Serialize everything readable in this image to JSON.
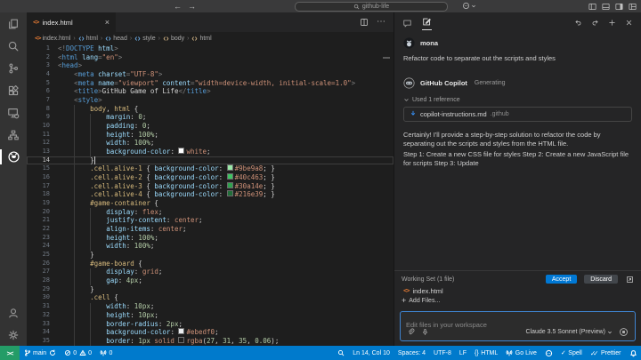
{
  "titlebar": {
    "search_value": "github-life"
  },
  "tabs": {
    "active": "index.html"
  },
  "breadcrumbs": [
    {
      "label": "index.html"
    },
    {
      "label": "html"
    },
    {
      "label": "head"
    },
    {
      "label": "style"
    },
    {
      "label": "body"
    },
    {
      "label": "html"
    }
  ],
  "editor": {
    "current_line": 14,
    "lines": [
      {
        "n": 1,
        "k": [
          [
            "p",
            "<!"
          ],
          [
            "t",
            "DOCTYPE"
          ],
          [
            "a",
            " html"
          ],
          [
            "p",
            ">"
          ]
        ]
      },
      {
        "n": 2,
        "k": [
          [
            "p",
            "<"
          ],
          [
            "t",
            "html"
          ],
          [
            "a",
            " lang"
          ],
          [
            "p",
            "="
          ],
          [
            "s",
            "\"en\""
          ],
          [
            "p",
            ">"
          ]
        ]
      },
      {
        "n": 3,
        "k": [
          [
            "p",
            "<"
          ],
          [
            "t",
            "head"
          ],
          [
            "p",
            ">"
          ]
        ]
      },
      {
        "n": 4,
        "k": [
          [
            "w",
            "    "
          ],
          [
            "p",
            "<"
          ],
          [
            "t",
            "meta"
          ],
          [
            "a",
            " charset"
          ],
          [
            "p",
            "="
          ],
          [
            "s",
            "\"UTF-8\""
          ],
          [
            "p",
            ">"
          ]
        ]
      },
      {
        "n": 5,
        "k": [
          [
            "w",
            "    "
          ],
          [
            "p",
            "<"
          ],
          [
            "t",
            "meta"
          ],
          [
            "a",
            " name"
          ],
          [
            "p",
            "="
          ],
          [
            "s",
            "\"viewport\""
          ],
          [
            "a",
            " content"
          ],
          [
            "p",
            "="
          ],
          [
            "s",
            "\"width=device-width, initial-scale=1.0\""
          ],
          [
            "p",
            ">"
          ]
        ]
      },
      {
        "n": 6,
        "k": [
          [
            "w",
            "    "
          ],
          [
            "p",
            "<"
          ],
          [
            "t",
            "title"
          ],
          [
            "p",
            ">"
          ],
          [
            "w",
            "GitHub Game of Life"
          ],
          [
            "p",
            "</"
          ],
          [
            "t",
            "title"
          ],
          [
            "p",
            ">"
          ]
        ]
      },
      {
        "n": 7,
        "k": [
          [
            "w",
            "    "
          ],
          [
            "p",
            "<"
          ],
          [
            "t",
            "style"
          ],
          [
            "p",
            ">"
          ]
        ]
      },
      {
        "n": 8,
        "k": [
          [
            "w",
            "        "
          ],
          [
            "e",
            "body"
          ],
          [
            "w",
            ","
          ],
          [
            "e",
            " html"
          ],
          [
            "w",
            " {"
          ]
        ]
      },
      {
        "n": 9,
        "k": [
          [
            "w",
            "            "
          ],
          [
            "r",
            "margin"
          ],
          [
            "w",
            ": "
          ],
          [
            "n",
            "0"
          ],
          [
            "w",
            ";"
          ]
        ]
      },
      {
        "n": 10,
        "k": [
          [
            "w",
            "            "
          ],
          [
            "r",
            "padding"
          ],
          [
            "w",
            ": "
          ],
          [
            "n",
            "0"
          ],
          [
            "w",
            ";"
          ]
        ]
      },
      {
        "n": 11,
        "k": [
          [
            "w",
            "            "
          ],
          [
            "r",
            "height"
          ],
          [
            "w",
            ": "
          ],
          [
            "n",
            "100%"
          ],
          [
            "w",
            ";"
          ]
        ]
      },
      {
        "n": 12,
        "k": [
          [
            "w",
            "            "
          ],
          [
            "r",
            "width"
          ],
          [
            "w",
            ": "
          ],
          [
            "n",
            "100%"
          ],
          [
            "w",
            ";"
          ]
        ]
      },
      {
        "n": 13,
        "k": [
          [
            "w",
            "            "
          ],
          [
            "r",
            "background-color"
          ],
          [
            "w",
            ": "
          ],
          [
            "sw",
            "#ffffff"
          ],
          [
            "v",
            "white"
          ],
          [
            "w",
            ";"
          ]
        ]
      },
      {
        "n": 14,
        "k": [
          [
            "w",
            "        }"
          ]
        ]
      },
      {
        "n": 15,
        "k": [
          [
            "w",
            "        "
          ],
          [
            "e",
            ".cell.alive-1"
          ],
          [
            "w",
            " { "
          ],
          [
            "r",
            "background-color"
          ],
          [
            "w",
            ": "
          ],
          [
            "sw",
            "#9be9a8"
          ],
          [
            "v",
            "#9be9a8"
          ],
          [
            "w",
            "; }"
          ]
        ]
      },
      {
        "n": 16,
        "k": [
          [
            "w",
            "        "
          ],
          [
            "e",
            ".cell.alive-2"
          ],
          [
            "w",
            " { "
          ],
          [
            "r",
            "background-color"
          ],
          [
            "w",
            ": "
          ],
          [
            "sw",
            "#40c463"
          ],
          [
            "v",
            "#40c463"
          ],
          [
            "w",
            "; }"
          ]
        ]
      },
      {
        "n": 17,
        "k": [
          [
            "w",
            "        "
          ],
          [
            "e",
            ".cell.alive-3"
          ],
          [
            "w",
            " { "
          ],
          [
            "r",
            "background-color"
          ],
          [
            "w",
            ": "
          ],
          [
            "sw",
            "#30a14e"
          ],
          [
            "v",
            "#30a14e"
          ],
          [
            "w",
            "; }"
          ]
        ]
      },
      {
        "n": 18,
        "k": [
          [
            "w",
            "        "
          ],
          [
            "e",
            ".cell.alive-4"
          ],
          [
            "w",
            " { "
          ],
          [
            "r",
            "background-color"
          ],
          [
            "w",
            ": "
          ],
          [
            "sw",
            "#216e39"
          ],
          [
            "v",
            "#216e39"
          ],
          [
            "w",
            "; }"
          ]
        ]
      },
      {
        "n": 19,
        "k": [
          [
            "w",
            "        "
          ],
          [
            "e",
            "#game-container"
          ],
          [
            "w",
            " {"
          ]
        ]
      },
      {
        "n": 20,
        "k": [
          [
            "w",
            "            "
          ],
          [
            "r",
            "display"
          ],
          [
            "w",
            ": "
          ],
          [
            "v",
            "flex"
          ],
          [
            "w",
            ";"
          ]
        ]
      },
      {
        "n": 21,
        "k": [
          [
            "w",
            "            "
          ],
          [
            "r",
            "justify-content"
          ],
          [
            "w",
            ": "
          ],
          [
            "v",
            "center"
          ],
          [
            "w",
            ";"
          ]
        ]
      },
      {
        "n": 22,
        "k": [
          [
            "w",
            "            "
          ],
          [
            "r",
            "align-items"
          ],
          [
            "w",
            ": "
          ],
          [
            "v",
            "center"
          ],
          [
            "w",
            ";"
          ]
        ]
      },
      {
        "n": 23,
        "k": [
          [
            "w",
            "            "
          ],
          [
            "r",
            "height"
          ],
          [
            "w",
            ": "
          ],
          [
            "n",
            "100%"
          ],
          [
            "w",
            ";"
          ]
        ]
      },
      {
        "n": 24,
        "k": [
          [
            "w",
            "            "
          ],
          [
            "r",
            "width"
          ],
          [
            "w",
            ": "
          ],
          [
            "n",
            "100%"
          ],
          [
            "w",
            ";"
          ]
        ]
      },
      {
        "n": 25,
        "k": [
          [
            "w",
            "        }"
          ]
        ]
      },
      {
        "n": 26,
        "k": [
          [
            "w",
            "        "
          ],
          [
            "e",
            "#game-board"
          ],
          [
            "w",
            " {"
          ]
        ]
      },
      {
        "n": 27,
        "k": [
          [
            "w",
            "            "
          ],
          [
            "r",
            "display"
          ],
          [
            "w",
            ": "
          ],
          [
            "v",
            "grid"
          ],
          [
            "w",
            ";"
          ]
        ]
      },
      {
        "n": 28,
        "k": [
          [
            "w",
            "            "
          ],
          [
            "r",
            "gap"
          ],
          [
            "w",
            ": "
          ],
          [
            "n",
            "4px"
          ],
          [
            "w",
            ";"
          ]
        ]
      },
      {
        "n": 29,
        "k": [
          [
            "w",
            "        }"
          ]
        ]
      },
      {
        "n": 30,
        "k": [
          [
            "w",
            "        "
          ],
          [
            "e",
            ".cell"
          ],
          [
            "w",
            " {"
          ]
        ]
      },
      {
        "n": 31,
        "k": [
          [
            "w",
            "            "
          ],
          [
            "r",
            "width"
          ],
          [
            "w",
            ": "
          ],
          [
            "n",
            "10px"
          ],
          [
            "w",
            ";"
          ]
        ]
      },
      {
        "n": 32,
        "k": [
          [
            "w",
            "            "
          ],
          [
            "r",
            "height"
          ],
          [
            "w",
            ": "
          ],
          [
            "n",
            "10px"
          ],
          [
            "w",
            ";"
          ]
        ]
      },
      {
        "n": 33,
        "k": [
          [
            "w",
            "            "
          ],
          [
            "r",
            "border-radius"
          ],
          [
            "w",
            ": "
          ],
          [
            "n",
            "2px"
          ],
          [
            "w",
            ";"
          ]
        ]
      },
      {
        "n": 34,
        "k": [
          [
            "w",
            "            "
          ],
          [
            "r",
            "background-color"
          ],
          [
            "w",
            ": "
          ],
          [
            "sw",
            "#ebedf0"
          ],
          [
            "v",
            "#ebedf0"
          ],
          [
            "w",
            ";"
          ]
        ]
      },
      {
        "n": 35,
        "k": [
          [
            "w",
            "            "
          ],
          [
            "r",
            "border"
          ],
          [
            "w",
            ": "
          ],
          [
            "n",
            "1px"
          ],
          [
            "w",
            " "
          ],
          [
            "v",
            "solid"
          ],
          [
            "w",
            " "
          ],
          [
            "swo",
            ""
          ],
          [
            "v",
            "rgba"
          ],
          [
            "w",
            "("
          ],
          [
            "n",
            "27"
          ],
          [
            "w",
            ", "
          ],
          [
            "n",
            "31"
          ],
          [
            "w",
            ", "
          ],
          [
            "n",
            "35"
          ],
          [
            "w",
            ", "
          ],
          [
            "n",
            "0.06"
          ],
          [
            "w",
            ")"
          ],
          [
            "w",
            ";"
          ]
        ]
      }
    ]
  },
  "chat": {
    "user_name": "mona",
    "user_message": "Refactor code to separate out the scripts and styles",
    "assistant_name": "GitHub Copilot",
    "assistant_status": "Generating",
    "reference_toggle": "Used 1 reference",
    "reference_file": "copilot-instructions.md",
    "reference_path": ".github",
    "response_p1": "Certainly! I'll provide a step-by-step solution to refactor the code by separating out the scripts and styles from the HTML file.",
    "response_p2": "Step 1: Create a new CSS file for styles Step 2: Create a new JavaScript file for scripts Step 3: Update",
    "working_set_title": "Working Set (1 file)",
    "accept_label": "Accept",
    "discard_label": "Discard",
    "working_file": "index.html",
    "add_files_label": "Add Files...",
    "input_placeholder": "Edit files in your workspace",
    "model_label": "Claude 3.5 Sonnet (Preview)"
  },
  "status_bar": {
    "remote": "><",
    "branch": "main",
    "errors": "0",
    "warnings": "0",
    "ports": "0",
    "line_col": "Ln 14, Col 10",
    "spaces": "Spaces: 4",
    "encoding": "UTF-8",
    "eol": "LF",
    "lang_braces": "{}",
    "language": "HTML",
    "go_live": "Go Live",
    "spell": "Spell",
    "prettier": "Prettier"
  },
  "colors": {
    "statusbar_blue": "#007acc",
    "remote_green": "#249c67",
    "accept_blue": "#0078d4",
    "input_focus_border": "#3f84d0",
    "html_icon_orange": "#e37933"
  }
}
